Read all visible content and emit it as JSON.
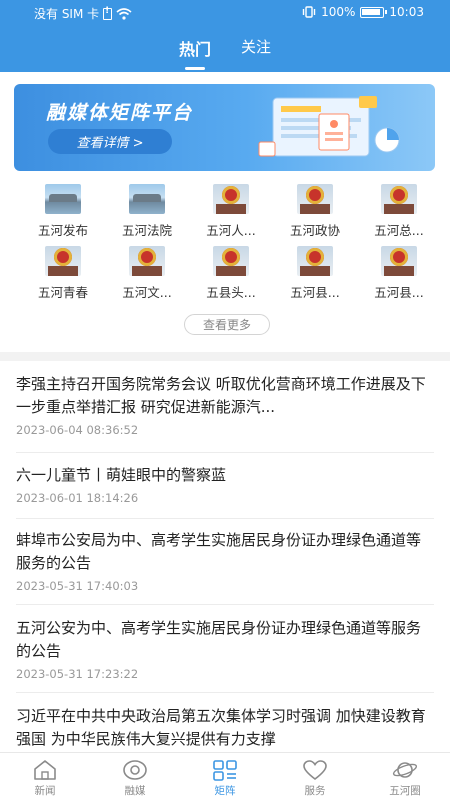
{
  "status_bar": {
    "carrier": "没有 SIM 卡",
    "battery": "100%",
    "time": "10:03"
  },
  "tabs": [
    {
      "label": "热门",
      "active": true
    },
    {
      "label": "关注",
      "active": false
    }
  ],
  "banner": {
    "title": "融媒体矩阵平台",
    "button": "查看详情 >"
  },
  "grid_items": [
    {
      "label": "五河发布",
      "thumb": "lake"
    },
    {
      "label": "五河法院",
      "thumb": "lake"
    },
    {
      "label": "五河人...",
      "thumb": "emblem"
    },
    {
      "label": "五河政协",
      "thumb": "emblem"
    },
    {
      "label": "五河总...",
      "thumb": "emblem"
    },
    {
      "label": "五河青春",
      "thumb": "emblem"
    },
    {
      "label": "五河文...",
      "thumb": "emblem"
    },
    {
      "label": "五县头...",
      "thumb": "emblem"
    },
    {
      "label": "五河县...",
      "thumb": "emblem"
    },
    {
      "label": "五河县...",
      "thumb": "emblem"
    }
  ],
  "more_button": "查看更多",
  "news": [
    {
      "title": "李强主持召开国务院常务会议 听取优化营商环境工作进展及下一步重点举措汇报 研究促进新能源汽...",
      "time": "2023-06-04 08:36:52"
    },
    {
      "title": "六一儿童节丨萌娃眼中的警察蓝",
      "time": "2023-06-01 18:14:26"
    },
    {
      "title": "蚌埠市公安局为中、高考学生实施居民身份证办理绿色通道等服务的公告",
      "time": "2023-05-31 17:40:03"
    },
    {
      "title": "五河公安为中、高考学生实施居民身份证办理绿色通道等服务的公告",
      "time": "2023-05-31 17:23:22"
    },
    {
      "title": "习近平在中共中央政治局第五次集体学习时强调 加快建设教育强国 为中华民族伟大复兴提供有力支撑",
      "time": ""
    }
  ],
  "bottom_nav": [
    {
      "label": "新闻",
      "icon": "home-icon",
      "active": false
    },
    {
      "label": "融媒",
      "icon": "media-icon",
      "active": false
    },
    {
      "label": "矩阵",
      "icon": "matrix-icon",
      "active": true
    },
    {
      "label": "服务",
      "icon": "heart-icon",
      "active": false
    },
    {
      "label": "五河圈",
      "icon": "planet-icon",
      "active": false
    }
  ],
  "colors": {
    "primary": "#3c96e3",
    "text": "#222222",
    "muted": "#999999"
  }
}
